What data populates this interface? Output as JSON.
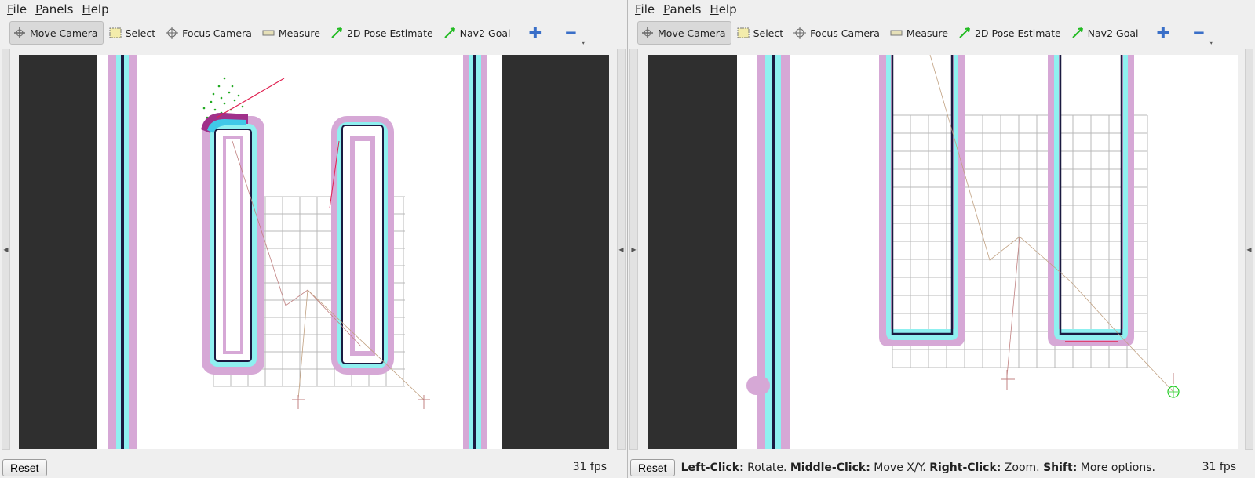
{
  "menu": {
    "file": "File",
    "panels": "Panels",
    "help": "Help"
  },
  "toolbar": {
    "move_camera": "Move Camera",
    "select": "Select",
    "focus_camera": "Focus Camera",
    "measure": "Measure",
    "pose_estimate": "2D Pose Estimate",
    "nav2_goal": "Nav2 Goal",
    "plus_icon": "plus-icon",
    "minus_icon": "minus-icon"
  },
  "status": {
    "reset": "Reset",
    "fps_left": "31 fps",
    "fps_right": "31 fps",
    "hint_left_click": "Left-Click:",
    "hint_rotate": " Rotate. ",
    "hint_middle_click": "Middle-Click:",
    "hint_move": " Move X/Y. ",
    "hint_right_click": "Right-Click:",
    "hint_zoom": " Zoom. ",
    "hint_shift": "Shift:",
    "hint_more": " More options."
  },
  "colors": {
    "inflation_outer": "#d6a8d6",
    "inflation_inner": "#8ff0f0",
    "wall": "#1a1a40",
    "grid": "#b8b8b8",
    "particles": "#22aa22",
    "dark_area": "#2f2f2f",
    "toolbar_icon_blue": "#3a6fc8",
    "pose_green": "#22cc22"
  }
}
